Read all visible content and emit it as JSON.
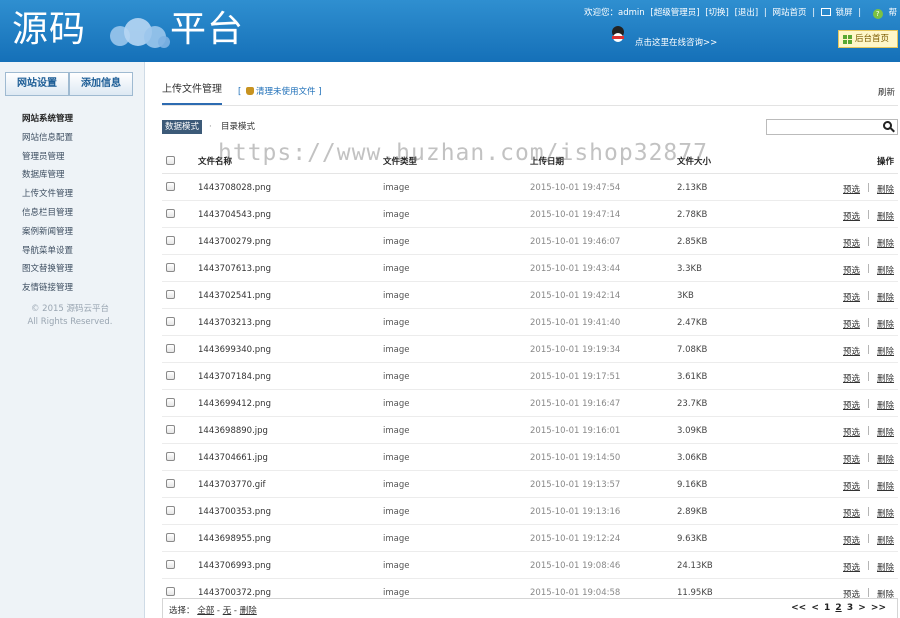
{
  "header": {
    "logo_left": "源码",
    "logo_right": "平台",
    "welcome": "欢迎您：admin",
    "role": "[超级管理员]",
    "switch": "[切换]",
    "logout": "[退出]",
    "site_home": "网站首页",
    "lock_screen": "锁屏",
    "help": "帮",
    "qq_link": "点击这里在线咨询>>",
    "admin_home": "后台首页"
  },
  "sidebar": {
    "tabs": [
      "网站设置",
      "添加信息"
    ],
    "items": [
      "网站系统管理",
      "网站信息配置",
      "管理员管理",
      "数据库管理",
      "上传文件管理",
      "信息栏目管理",
      "案例新闻管理",
      "导航菜单设置",
      "图文替换管理",
      "友情链接管理"
    ],
    "copyright_line1": "© 2015 源码云平台",
    "copyright_line2": "All Rights Reserved."
  },
  "main": {
    "title": "上传文件管理",
    "cleanup_link": "清理未使用文件",
    "refresh": "刷新",
    "mode_data": "数据模式",
    "mode_sep": "·",
    "mode_dir": "目录模式",
    "search_placeholder": "",
    "columns": {
      "name": "文件名称",
      "type": "文件类型",
      "date": "上传日期",
      "size": "文件大小",
      "action": "操作"
    },
    "rows": [
      {
        "name": "1443708028.png",
        "type": "image",
        "date": "2015-10-01 19:47:54",
        "size": "2.13KB"
      },
      {
        "name": "1443704543.png",
        "type": "image",
        "date": "2015-10-01 19:47:14",
        "size": "2.78KB"
      },
      {
        "name": "1443700279.png",
        "type": "image",
        "date": "2015-10-01 19:46:07",
        "size": "2.85KB"
      },
      {
        "name": "1443707613.png",
        "type": "image",
        "date": "2015-10-01 19:43:44",
        "size": "3.3KB"
      },
      {
        "name": "1443702541.png",
        "type": "image",
        "date": "2015-10-01 19:42:14",
        "size": "3KB"
      },
      {
        "name": "1443703213.png",
        "type": "image",
        "date": "2015-10-01 19:41:40",
        "size": "2.47KB"
      },
      {
        "name": "1443699340.png",
        "type": "image",
        "date": "2015-10-01 19:19:34",
        "size": "7.08KB"
      },
      {
        "name": "1443707184.png",
        "type": "image",
        "date": "2015-10-01 19:17:51",
        "size": "3.61KB"
      },
      {
        "name": "1443699412.png",
        "type": "image",
        "date": "2015-10-01 19:16:47",
        "size": "23.7KB"
      },
      {
        "name": "1443698890.jpg",
        "type": "image",
        "date": "2015-10-01 19:16:01",
        "size": "3.09KB"
      },
      {
        "name": "1443704661.jpg",
        "type": "image",
        "date": "2015-10-01 19:14:50",
        "size": "3.06KB"
      },
      {
        "name": "1443703770.gif",
        "type": "image",
        "date": "2015-10-01 19:13:57",
        "size": "9.16KB"
      },
      {
        "name": "1443700353.png",
        "type": "image",
        "date": "2015-10-01 19:13:16",
        "size": "2.89KB"
      },
      {
        "name": "1443698955.png",
        "type": "image",
        "date": "2015-10-01 19:12:24",
        "size": "9.63KB"
      },
      {
        "name": "1443706993.png",
        "type": "image",
        "date": "2015-10-01 19:08:46",
        "size": "24.13KB"
      },
      {
        "name": "1443700372.png",
        "type": "image",
        "date": "2015-10-01 19:04:58",
        "size": "11.95KB"
      }
    ],
    "action_preview": "预选",
    "action_sep": "|",
    "action_delete": "删除",
    "select_label": "选择：",
    "select_all": "全部",
    "select_none": "无",
    "select_delete": "删除",
    "pager": {
      "first": "<<",
      "prev": "<",
      "pages": [
        "1",
        "2",
        "3"
      ],
      "next": ">",
      "last": ">>"
    }
  },
  "watermark": "https://www.huzhan.com/ishop32877"
}
